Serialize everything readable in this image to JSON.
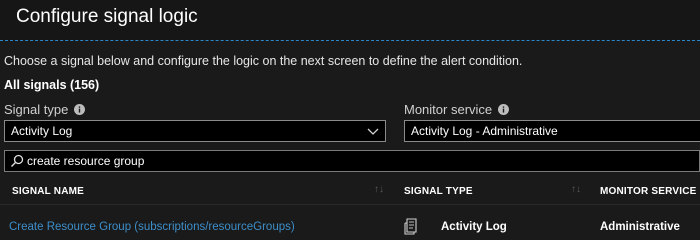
{
  "blade": {
    "title": "Configure signal logic",
    "description": "Choose a signal below and configure the logic on the next screen to define the alert condition.",
    "all_signals_label": "All signals (156)"
  },
  "filters": {
    "signal_type_label": "Signal type",
    "signal_type_value": "Activity Log",
    "monitor_service_label": "Monitor service",
    "monitor_service_value": "Activity Log - Administrative"
  },
  "search": {
    "value": "create resource group"
  },
  "table": {
    "columns": [
      "SIGNAL NAME",
      "SIGNAL TYPE",
      "MONITOR SERVICE"
    ],
    "rows": [
      {
        "signal_name": "Create Resource Group (subscriptions/resourceGroups)",
        "signal_type": "Activity Log",
        "monitor_service": "Administrative"
      }
    ]
  },
  "icons": {
    "info": "info-icon",
    "chevron": "chevron-down-icon",
    "search": "search-icon",
    "signal_type_row": "document-icon",
    "sort": "sort-icon"
  },
  "colors": {
    "accent_link": "#3d8ec9",
    "separator": "#2b87c9",
    "background": "#1a1a1a"
  }
}
